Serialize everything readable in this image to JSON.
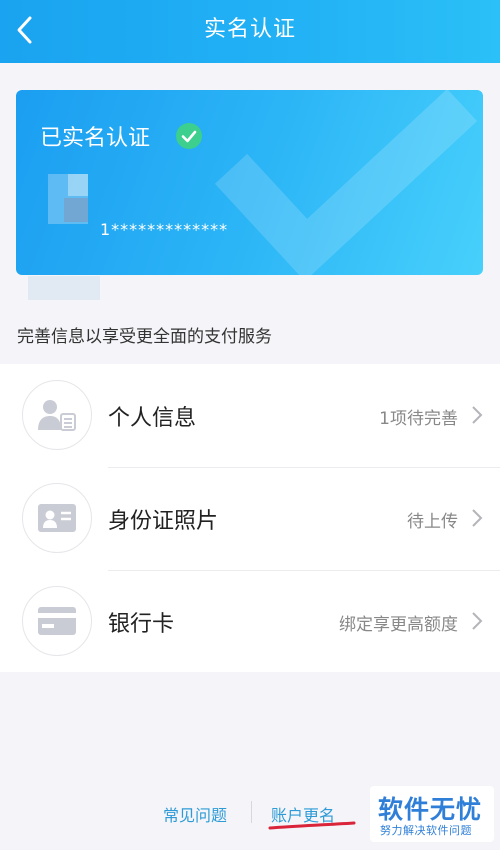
{
  "header": {
    "title": "实名认证"
  },
  "card": {
    "status": "已实名认证",
    "id_number": "1*************"
  },
  "hint": "完善信息以享受更全面的支付服务",
  "items": [
    {
      "label": "个人信息",
      "status": "1项待完善",
      "icon": "person-id-icon"
    },
    {
      "label": "身份证照片",
      "status": "待上传",
      "icon": "id-card-icon"
    },
    {
      "label": "银行卡",
      "status": "绑定享更高额度",
      "icon": "bank-card-icon"
    }
  ],
  "footer": {
    "faq": "常见问题",
    "rename": "账户更名"
  },
  "watermark": {
    "main": "软件无忧",
    "sub": "努力解决软件问题"
  },
  "colors": {
    "header": "#1aa3f0",
    "card_gradient_start": "#1b9ef1",
    "card_gradient_end": "#47d0fb",
    "verified_badge": "#3ccf8e",
    "link": "#2e9bd6",
    "annotation": "#d9243a",
    "watermark_text": "#2f7fd8"
  }
}
